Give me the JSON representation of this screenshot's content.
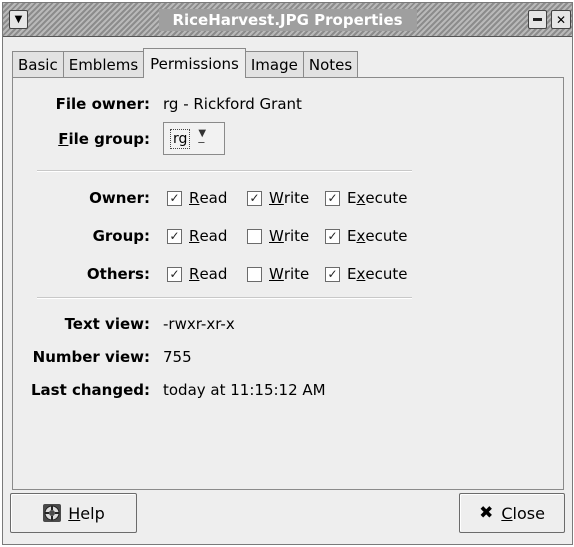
{
  "window": {
    "title": "RiceHarvest.JPG Properties"
  },
  "tabs": [
    {
      "label": "Basic"
    },
    {
      "label": "Emblems"
    },
    {
      "label": "Permissions",
      "active": true
    },
    {
      "label": "Image"
    },
    {
      "label": "Notes"
    }
  ],
  "permissions": {
    "file_owner_label": "File owner:",
    "file_owner_value": "rg - Rickford Grant",
    "file_group_label_first": "F",
    "file_group_label_rest": "ile group:",
    "file_group_value": "rg",
    "rows": [
      {
        "label": "Owner:",
        "read": true,
        "write": true,
        "execute": true
      },
      {
        "label": "Group:",
        "read": true,
        "write": false,
        "execute": true
      },
      {
        "label": "Others:",
        "read": true,
        "write": false,
        "execute": true
      }
    ],
    "read_u": "R",
    "read_rest": "ead",
    "write_u": "W",
    "write_rest": "rite",
    "exec_pre": "E",
    "exec_u": "x",
    "exec_rest": "ecute",
    "text_view_label": "Text view:",
    "text_view_value": "-rwxr-xr-x",
    "number_view_label": "Number view:",
    "number_view_value": "755",
    "last_changed_label": "Last changed:",
    "last_changed_value": "today at 11:15:12 AM"
  },
  "buttons": {
    "help_u": "H",
    "help_rest": "elp",
    "close_u": "C",
    "close_rest": "lose"
  },
  "colors": {
    "window_bg": "#eeeeee",
    "title_text": "#ffffff"
  }
}
